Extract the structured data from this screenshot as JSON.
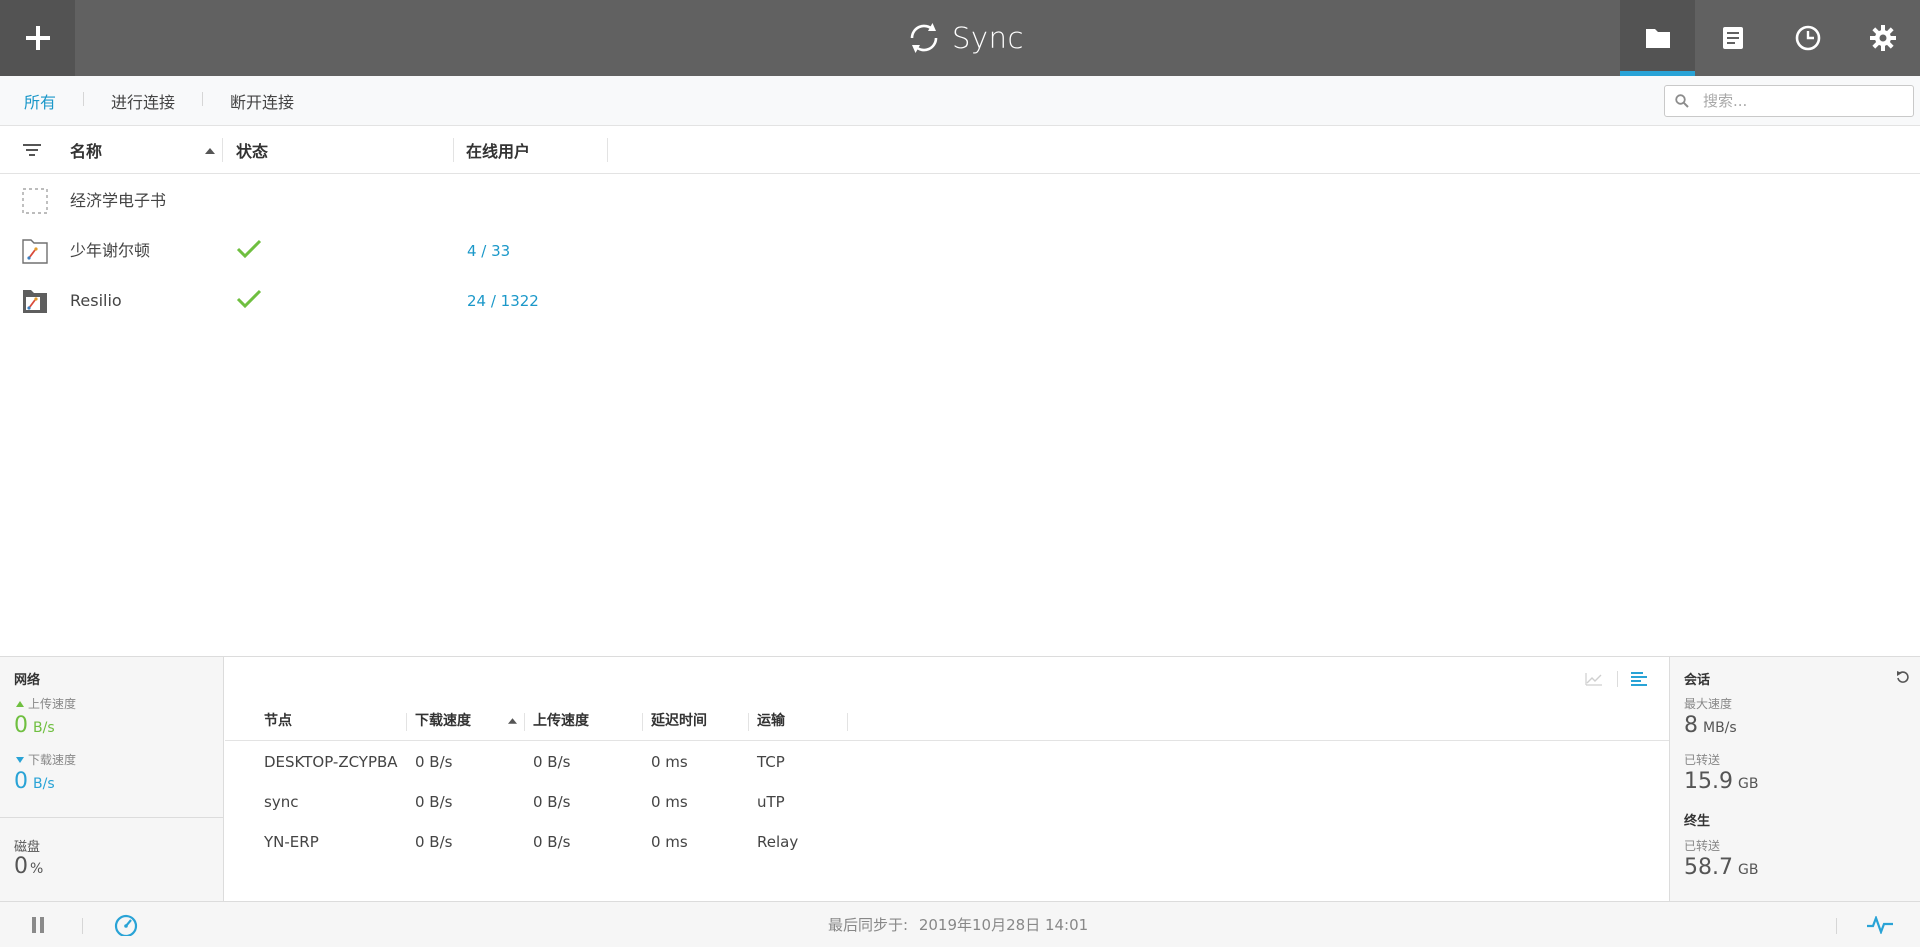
{
  "app": {
    "title": "Sync",
    "brand_color": "#29a3d6",
    "topbar_color": "#616161"
  },
  "toolbar": {
    "add_icon": "plus-icon",
    "nav_icons": [
      "folder-icon",
      "document-icon",
      "clock-icon",
      "gear-icon"
    ],
    "active_nav": "folder-icon"
  },
  "filters": {
    "tabs": [
      "所有",
      "进行连接",
      "断开连接"
    ],
    "active": "所有"
  },
  "search": {
    "placeholder": "搜索..."
  },
  "folders_table": {
    "columns": [
      "名称",
      "状态",
      "在线用户"
    ],
    "sort_column": "名称",
    "rows": [
      {
        "name": "经济学电子书",
        "status": "",
        "peers": "",
        "icon": "folder-placeholder-icon"
      },
      {
        "name": "少年谢尔顿",
        "status": "check",
        "peers": "4 / 33",
        "icon": "folder-broken-image-icon"
      },
      {
        "name": "Resilio",
        "status": "check",
        "peers": "24 / 1322",
        "icon": "folder-broken-image-dark-icon"
      }
    ]
  },
  "network": {
    "title": "网络",
    "upload_label": "上传速度",
    "upload_value": "0",
    "upload_unit": "B/s",
    "download_label": "下载速度",
    "download_value": "0",
    "download_unit": "B/s",
    "disk_label": "磁盘",
    "disk_value": "0",
    "disk_unit": "%"
  },
  "peers_table": {
    "columns": [
      "节点",
      "下载速度",
      "上传速度",
      "延迟时间",
      "运输"
    ],
    "sort_column": "下载速度",
    "rows": [
      {
        "node": "DESKTOP-ZCYPBA",
        "down": "0 B/s",
        "up": "0 B/s",
        "latency": "0 ms",
        "transport": "TCP"
      },
      {
        "node": "sync",
        "down": "0 B/s",
        "up": "0 B/s",
        "latency": "0 ms",
        "transport": "uTP"
      },
      {
        "node": "YN-ERP",
        "down": "0 B/s",
        "up": "0 B/s",
        "latency": "0 ms",
        "transport": "Relay"
      }
    ]
  },
  "session": {
    "title": "会话",
    "max_speed_label": "最大速度",
    "max_speed_value": "8",
    "max_speed_unit": "MB/s",
    "transferred_label": "已转送",
    "transferred_value": "15.9",
    "transferred_unit": "GB",
    "lifetime_title": "终生",
    "lifetime_label": "已转送",
    "lifetime_value": "58.7",
    "lifetime_unit": "GB"
  },
  "statusbar": {
    "last_sync_label": "最后同步于:",
    "last_sync_value": "2019年10月28日 14:01"
  }
}
